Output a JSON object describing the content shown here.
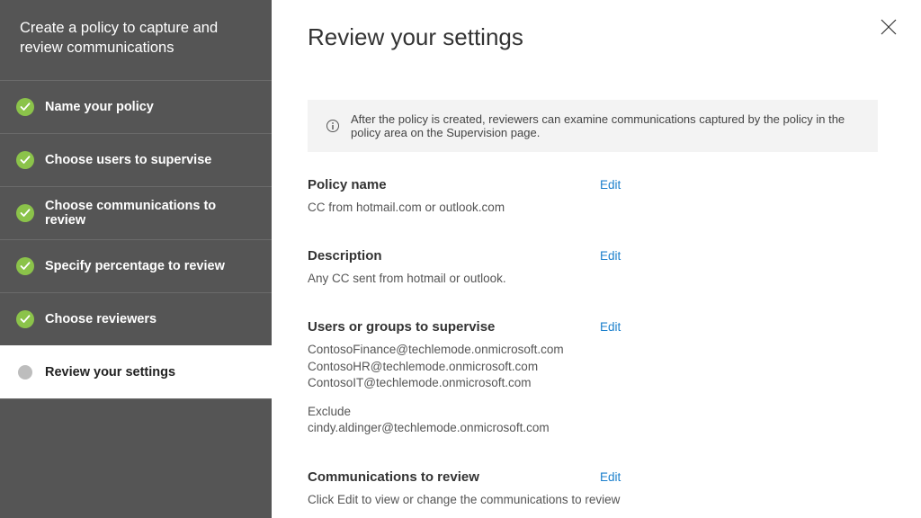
{
  "sidebar": {
    "title": "Create a policy to capture and review communications",
    "steps": [
      {
        "label": "Name your policy",
        "state": "done"
      },
      {
        "label": "Choose users to supervise",
        "state": "done"
      },
      {
        "label": "Choose communications to review",
        "state": "done"
      },
      {
        "label": "Specify percentage to review",
        "state": "done"
      },
      {
        "label": "Choose reviewers",
        "state": "done"
      },
      {
        "label": "Review your settings",
        "state": "current"
      }
    ]
  },
  "main": {
    "title": "Review your settings",
    "callout": "After the policy is created, reviewers can examine communications captured by the policy in the policy area on the Supervision page.",
    "edit_label": "Edit",
    "sections": {
      "policy_name": {
        "title": "Policy name",
        "value": "CC from hotmail.com or outlook.com"
      },
      "description": {
        "title": "Description",
        "value": "Any CC sent from hotmail or outlook."
      },
      "users": {
        "title": "Users or groups to supervise",
        "include": [
          "ContosoFinance@techlemode.onmicrosoft.com",
          "ContosoHR@techlemode.onmicrosoft.com",
          "ContosoIT@techlemode.onmicrosoft.com"
        ],
        "exclude_label": "Exclude",
        "exclude": [
          "cindy.aldinger@techlemode.onmicrosoft.com"
        ]
      },
      "comms": {
        "title": "Communications to review",
        "value": "Click Edit to view or change the communications to review"
      }
    }
  }
}
